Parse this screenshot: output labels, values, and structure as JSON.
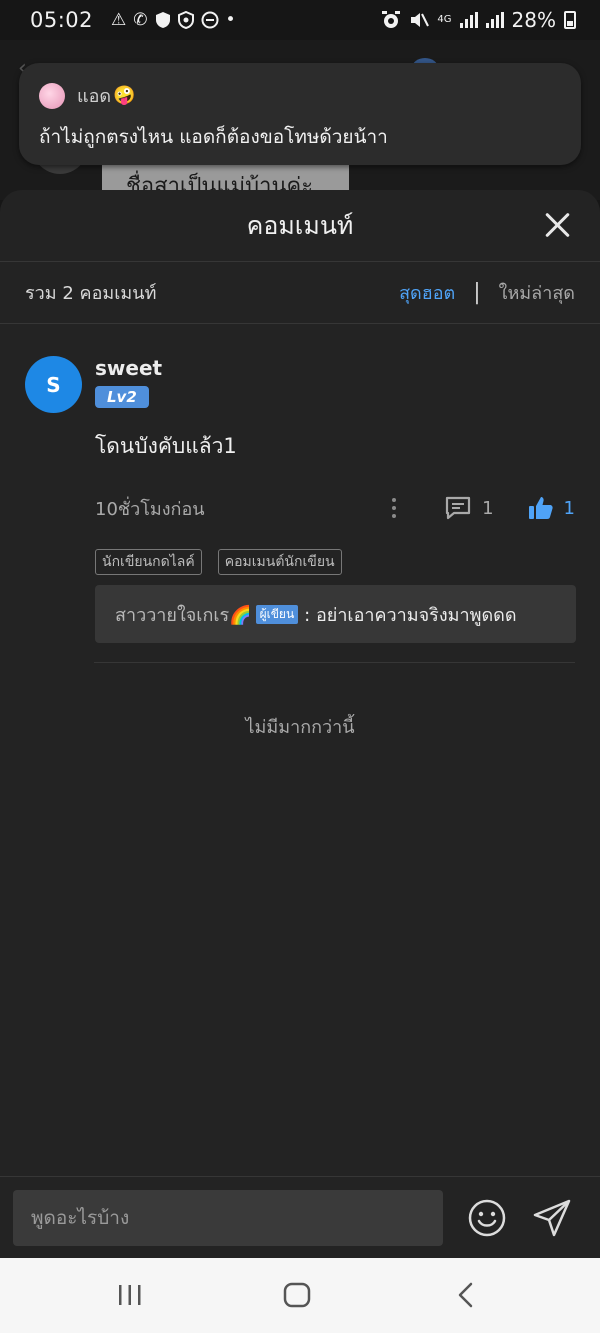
{
  "status_bar": {
    "time": "05:02",
    "network": "4G",
    "battery": "28%"
  },
  "background_page": {
    "snippet": "ชื่อสาเป็นแม่บ้านค่ะ"
  },
  "notification": {
    "name": "แอด",
    "emoji": "🤪",
    "message": "ถ้าไม่ถูกตรงไหน แอดก็ต้องขอโทษด้วยน้าา"
  },
  "sheet": {
    "title": "คอมเมนท์",
    "total": "รวม 2 คอมเมนท์",
    "sort_hot": "สุดฮอต",
    "separator": "|",
    "sort_new": "ใหม่ล่าสุด"
  },
  "comment": {
    "avatar_letter": "S",
    "avatar_color": "#1e88e5",
    "username": "sweet",
    "level": "Lv2",
    "text": "โดนบังคับแล้ว1",
    "time": "10ชั่วโมงก่อน",
    "reply_count": "1",
    "like_count": "1",
    "tags": [
      "นักเขียนกดไลค์",
      "คอมเมนต์นักเขียน"
    ],
    "reply": {
      "author": "สาววายใจเกเร🌈",
      "badge": "ผู้เขียน",
      "text": ": อย่าเอาความจริงมาพูดดด"
    }
  },
  "no_more": "ไม่มีมากกว่านี้",
  "input": {
    "placeholder": "พูดอะไรบ้าง"
  },
  "colors": {
    "accent": "#4fa3f7",
    "sheet_bg": "#232323"
  }
}
